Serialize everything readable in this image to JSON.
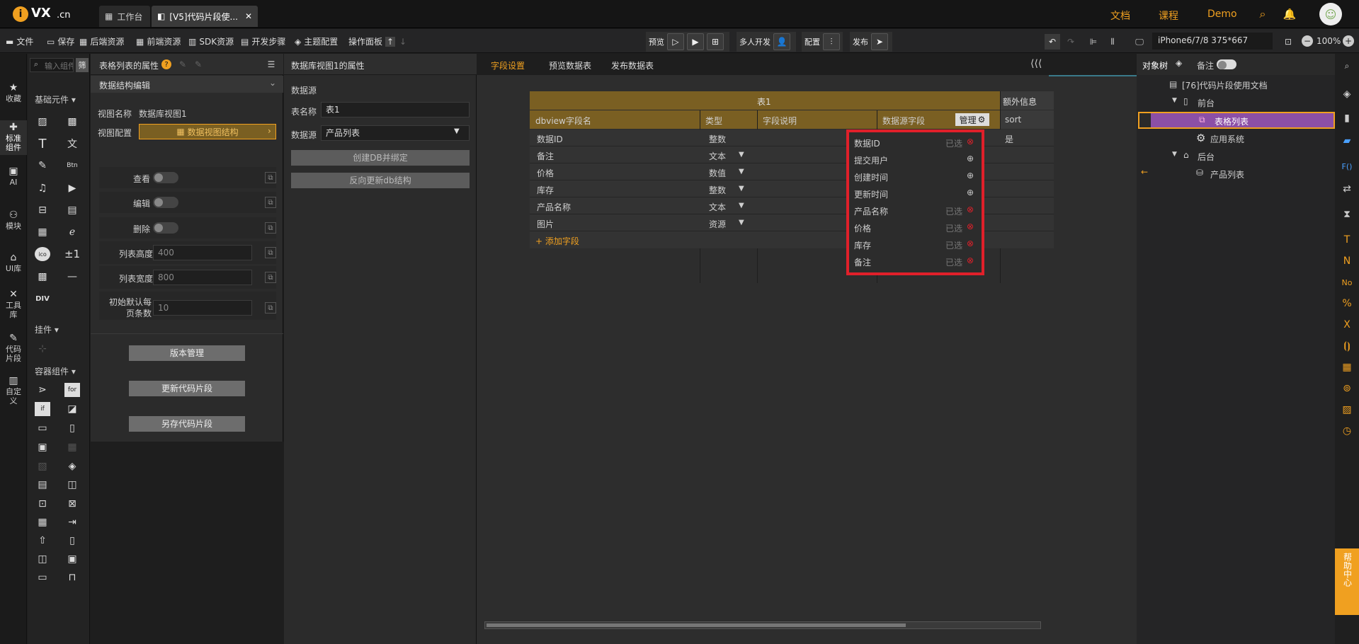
{
  "brand": {
    "logo_text": "VX",
    "logo_suffix": ".cn"
  },
  "tabs": [
    {
      "label": "工作台"
    },
    {
      "label": "[V5]代码片段使..."
    }
  ],
  "topnav": {
    "docs": "文档",
    "course": "课程",
    "demo": "Demo"
  },
  "toolbar": {
    "file": "文件",
    "save": "保存",
    "backend_res": "后端资源",
    "frontend_res": "前端资源",
    "sdk_res": "SDK资源",
    "dev_steps": "开发步骤",
    "theme": "主题配置",
    "op_panel": "操作面板",
    "preview": "预览",
    "multi_dev": "多人开发",
    "config": "配置",
    "publish": "发布",
    "device": "iPhone6/7/8 375*667",
    "zoom": "100%"
  },
  "leftrail": [
    {
      "label": "收藏"
    },
    {
      "label": "标准\n组件"
    },
    {
      "label": "AI"
    },
    {
      "label": "模块"
    },
    {
      "label": "UI库"
    },
    {
      "label": "工具\n库"
    },
    {
      "label": "代码\n片段"
    },
    {
      "label": "自定\n义"
    }
  ],
  "palette": {
    "search_placeholder": "输入组件名称",
    "filter": "筛",
    "section_basic": "基础元件",
    "section_plugin": "挂件",
    "section_container": "容器组件",
    "div_label": "DIV",
    "for_label": "for",
    "if_label": "if",
    "pm_label": "±1",
    "btn_label": "Btn"
  },
  "propPanel": {
    "title": "表格列表的属性",
    "section": "数据结构编辑",
    "view_name_label": "视图名称",
    "view_name_value": "数据库视图1",
    "view_config_label": "视图配置",
    "view_config_btn": "数据视图结构",
    "view_label": "查看",
    "edit_label": "编辑",
    "delete_label": "删除",
    "height_label": "列表高度",
    "height_value": "400",
    "width_label": "列表宽度",
    "width_value": "800",
    "page_label": "初始默认每页条数",
    "page_value": "10",
    "version_btn": "版本管理",
    "update_btn": "更新代码片段",
    "saveas_btn": "另存代码片段"
  },
  "dbPanel": {
    "title": "数据库视图1的属性",
    "section": "数据源",
    "table_name_label": "表名称",
    "table_name_value": "表1",
    "datasource_label": "数据源",
    "datasource_value": "产品列表",
    "create_btn": "创建DB并绑定",
    "reverse_btn": "反向更新db结构"
  },
  "mainTabs": [
    {
      "label": "字段设置"
    },
    {
      "label": "预览数据表"
    },
    {
      "label": "发布数据表"
    }
  ],
  "table": {
    "group_title": "表1",
    "extra_title": "额外信息",
    "headers": [
      "dbview字段名",
      "类型",
      "字段说明",
      "数据源字段"
    ],
    "manage_btn": "管理",
    "extra_header": "sort",
    "rows": [
      {
        "name": "数据ID",
        "type": "整数",
        "extra": "是"
      },
      {
        "name": "备注",
        "type": "文本",
        "extra": ""
      },
      {
        "name": "价格",
        "type": "数值",
        "extra": ""
      },
      {
        "name": "库存",
        "type": "整数",
        "extra": ""
      },
      {
        "name": "产品名称",
        "type": "文本",
        "extra": ""
      },
      {
        "name": "图片",
        "type": "资源",
        "extra": ""
      }
    ],
    "add_field": "+ 添加字段"
  },
  "fieldPicker": {
    "items": [
      {
        "name": "数据ID",
        "status": "已选",
        "selected": true
      },
      {
        "name": "提交用户",
        "status": "",
        "selected": false
      },
      {
        "name": "创建时间",
        "status": "",
        "selected": false
      },
      {
        "name": "更新时间",
        "status": "",
        "selected": false
      },
      {
        "name": "产品名称",
        "status": "已选",
        "selected": true
      },
      {
        "name": "价格",
        "status": "已选",
        "selected": true
      },
      {
        "name": "库存",
        "status": "已选",
        "selected": true
      },
      {
        "name": "备注",
        "status": "已选",
        "selected": true
      }
    ]
  },
  "tree": {
    "tab_objects": "对象树",
    "tab_notes": "备注",
    "root": "[76]代码片段使用文档",
    "front": "前台",
    "table_list": "表格列表",
    "app_system": "应用系统",
    "back": "后台",
    "product_list": "产品列表"
  },
  "help": {
    "label": "帮助中心"
  },
  "colors": {
    "accent": "#f0a020",
    "header_gold": "#7a5f22",
    "highlight_red": "#e0202a",
    "selected_purple": "#8c4fa6"
  }
}
